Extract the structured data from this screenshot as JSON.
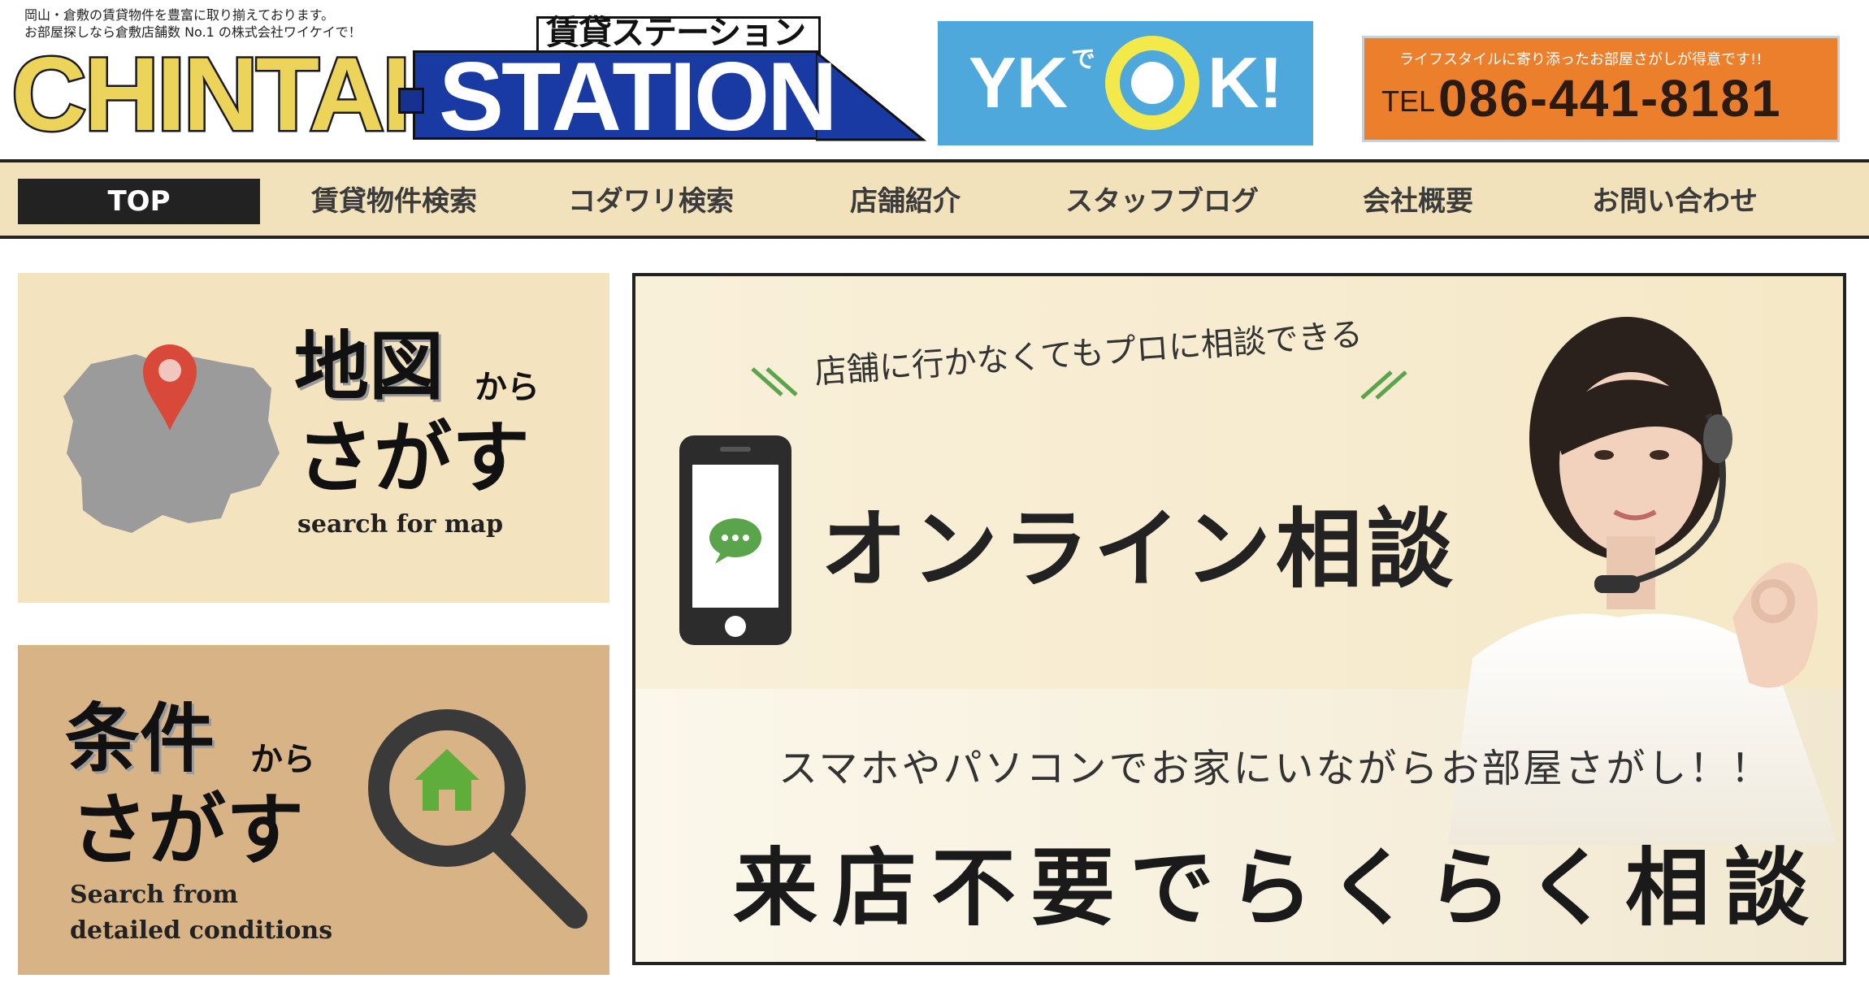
{
  "header": {
    "tagline_line1": "岡山・倉敷の賃貸物件を豊富に取り揃えております。",
    "tagline_line2": "お部屋探しなら倉敷店舗数 No.1 の株式会社ワイケイで！",
    "logo_left": "CHINTAI",
    "logo_right": "STATION",
    "logo_kana": "賃貸ステーション",
    "yk_banner": {
      "yk": "YK",
      "de": "で",
      "k_excl": "K!"
    },
    "tel_banner": {
      "tagline": "ライフスタイルに寄り添ったお部屋さがしが得意です!!",
      "prefix": "TEL",
      "number": "086-441-8181"
    }
  },
  "nav": {
    "items": [
      {
        "label": "TOP",
        "active": true
      },
      {
        "label": "賃貸物件検索"
      },
      {
        "label": "コダワリ検索"
      },
      {
        "label": "店舗紹介"
      },
      {
        "label": "スタッフブログ"
      },
      {
        "label": "会社概要"
      },
      {
        "label": "お問い合わせ"
      }
    ]
  },
  "cards": {
    "map": {
      "kanji": "地図",
      "kara": "から",
      "sagasu": "さがす",
      "sub": "search for map"
    },
    "conditions": {
      "kanji": "条件",
      "kara": "から",
      "sagasu": "さがす",
      "sub_line1": "Search from",
      "sub_line2": "detailed conditions"
    }
  },
  "main_banner": {
    "small": "店舗に行かなくてもプロに相談できる",
    "title": "オンライン相談",
    "sub": "スマホやパソコンでお家にいながらお部屋さがし！！",
    "main": "来店不要でらくらく相談"
  },
  "icons": {
    "map_pin": "map-pin-icon",
    "magnifier": "magnifier-house-icon",
    "phone": "smartphone-icon",
    "chat": "chat-bubble-icon"
  },
  "colors": {
    "nav_bg": "#f2e2bb",
    "logo_yellow": "#ecd35a",
    "logo_blue": "#1a3aa3",
    "yk_blue": "#4ea8dc",
    "tel_orange": "#ec7f2c"
  }
}
